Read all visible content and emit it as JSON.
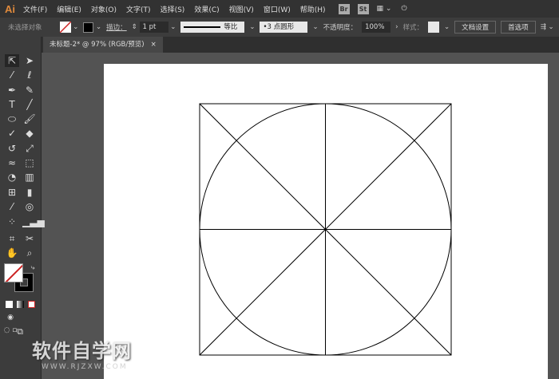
{
  "app": {
    "logo": "Ai"
  },
  "menu": [
    "文件(F)",
    "编辑(E)",
    "对象(O)",
    "文字(T)",
    "选择(S)",
    "效果(C)",
    "视图(V)",
    "窗口(W)",
    "帮助(H)"
  ],
  "menu_icons": {
    "bridge": "Br",
    "stock": "St"
  },
  "control": {
    "selection": "未选择对象",
    "stroke_label": "描边：",
    "stroke_value": "1 pt",
    "profile": "等比",
    "brush": "3 点圆形",
    "opacity_label": "不透明度：",
    "opacity_value": "100%",
    "style_label": "样式：",
    "doc_setup": "文档设置",
    "preferences": "首选项"
  },
  "tab": {
    "title": "未标题-2* @ 97% (RGB/预览)",
    "close": "×"
  },
  "watermark": {
    "text": "软件自学网",
    "url": "WWW.RJZXW.COM"
  },
  "colors": {
    "accent": "#e08a3c",
    "canvas": "#535353",
    "stroke": "#000000"
  }
}
